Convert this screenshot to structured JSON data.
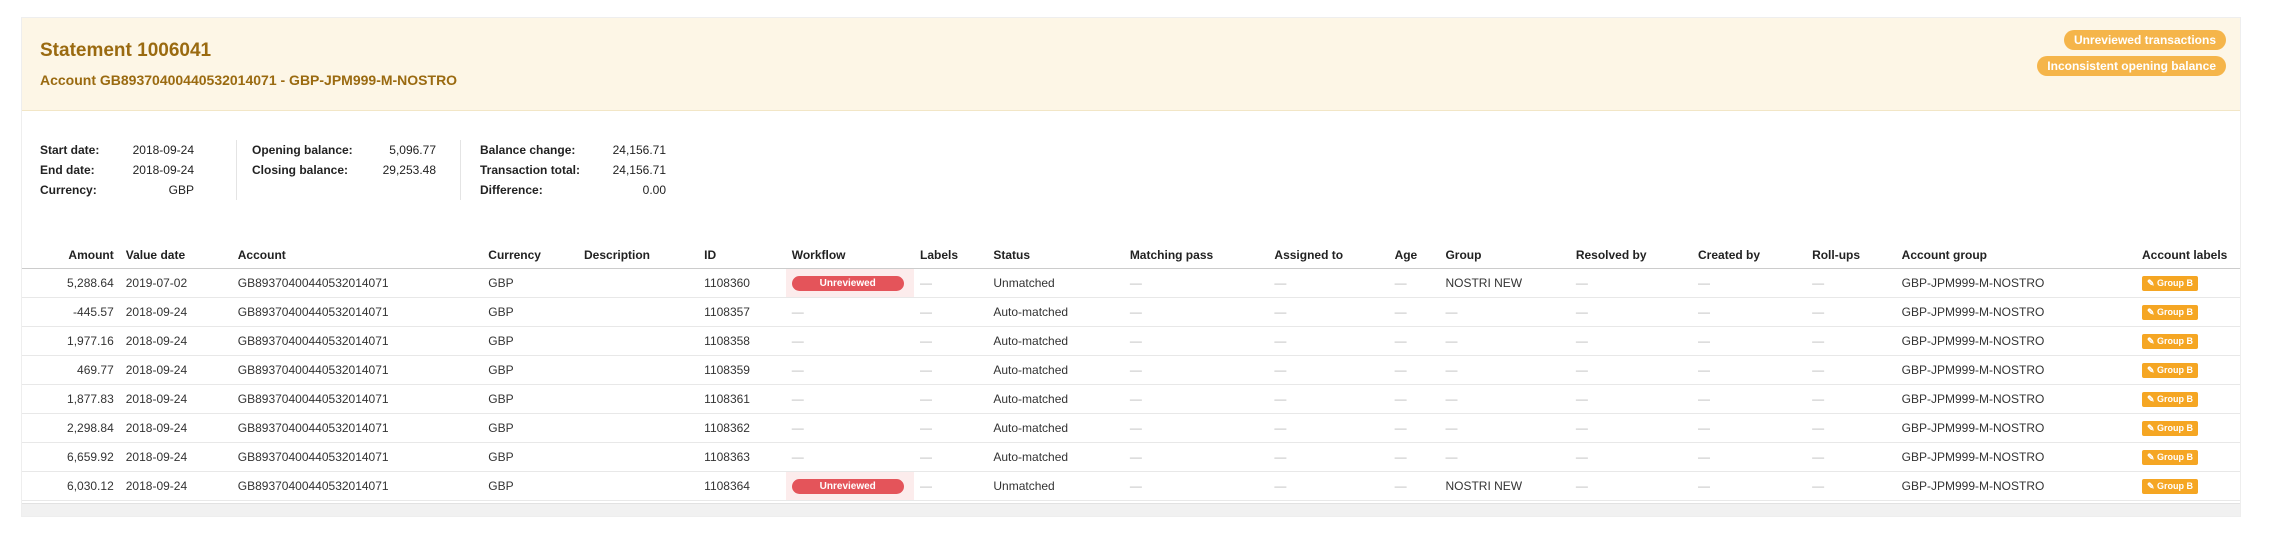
{
  "statement": {
    "title": "Statement 1006041",
    "account_line": "Account GB89370400440532014071 - GBP-JPM999-M-NOSTRO",
    "badges": [
      "Unreviewed transactions",
      "Inconsistent opening balance"
    ]
  },
  "summary": {
    "start_date_label": "Start date:",
    "start_date": "2018-09-24",
    "end_date_label": "End date:",
    "end_date": "2018-09-24",
    "currency_label": "Currency:",
    "currency": "GBP",
    "opening_balance_label": "Opening balance:",
    "opening_balance": "5,096.77",
    "closing_balance_label": "Closing balance:",
    "closing_balance": "29,253.48",
    "balance_change_label": "Balance change:",
    "balance_change": "24,156.71",
    "transaction_total_label": "Transaction total:",
    "transaction_total": "24,156.71",
    "difference_label": "Difference:",
    "difference": "0.00"
  },
  "table": {
    "columns": [
      "Amount",
      "Value date",
      "Account",
      "Currency",
      "Description",
      "ID",
      "Workflow",
      "Labels",
      "Status",
      "Matching pass",
      "Assigned to",
      "Age",
      "Group",
      "Resolved by",
      "Created by",
      "Roll-ups",
      "Account group",
      "Account labels"
    ],
    "dash": "—",
    "rows": [
      {
        "amount": "5,288.64",
        "value_date": "2019-07-02",
        "account": "GB89370400440532014071",
        "currency": "GBP",
        "id": "1108360",
        "workflow": "Unreviewed",
        "status": "Unmatched",
        "group": "NOSTRI NEW",
        "account_group": "GBP-JPM999-M-NOSTRO",
        "account_label": "Group B"
      },
      {
        "amount": "-445.57",
        "value_date": "2018-09-24",
        "account": "GB89370400440532014071",
        "currency": "GBP",
        "id": "1108357",
        "workflow": "",
        "status": "Auto-matched",
        "group": "",
        "account_group": "GBP-JPM999-M-NOSTRO",
        "account_label": "Group B"
      },
      {
        "amount": "1,977.16",
        "value_date": "2018-09-24",
        "account": "GB89370400440532014071",
        "currency": "GBP",
        "id": "1108358",
        "workflow": "",
        "status": "Auto-matched",
        "group": "",
        "account_group": "GBP-JPM999-M-NOSTRO",
        "account_label": "Group B"
      },
      {
        "amount": "469.77",
        "value_date": "2018-09-24",
        "account": "GB89370400440532014071",
        "currency": "GBP",
        "id": "1108359",
        "workflow": "",
        "status": "Auto-matched",
        "group": "",
        "account_group": "GBP-JPM999-M-NOSTRO",
        "account_label": "Group B"
      },
      {
        "amount": "1,877.83",
        "value_date": "2018-09-24",
        "account": "GB89370400440532014071",
        "currency": "GBP",
        "id": "1108361",
        "workflow": "",
        "status": "Auto-matched",
        "group": "",
        "account_group": "GBP-JPM999-M-NOSTRO",
        "account_label": "Group B"
      },
      {
        "amount": "2,298.84",
        "value_date": "2018-09-24",
        "account": "GB89370400440532014071",
        "currency": "GBP",
        "id": "1108362",
        "workflow": "",
        "status": "Auto-matched",
        "group": "",
        "account_group": "GBP-JPM999-M-NOSTRO",
        "account_label": "Group B"
      },
      {
        "amount": "6,659.92",
        "value_date": "2018-09-24",
        "account": "GB89370400440532014071",
        "currency": "GBP",
        "id": "1108363",
        "workflow": "",
        "status": "Auto-matched",
        "group": "",
        "account_group": "GBP-JPM999-M-NOSTRO",
        "account_label": "Group B"
      },
      {
        "amount": "6,030.12",
        "value_date": "2018-09-24",
        "account": "GB89370400440532014071",
        "currency": "GBP",
        "id": "1108364",
        "workflow": "Unreviewed",
        "status": "Unmatched",
        "group": "NOSTRI NEW",
        "account_group": "GBP-JPM999-M-NOSTRO",
        "account_label": "Group B"
      }
    ]
  },
  "colors": {
    "header_bg": "#fdf6e6",
    "title": "#9a6a10",
    "badge": "#f5b54a",
    "unreviewed": "#e4545a",
    "tag": "#f5a623"
  },
  "icons": {
    "tag": "tag-icon"
  }
}
